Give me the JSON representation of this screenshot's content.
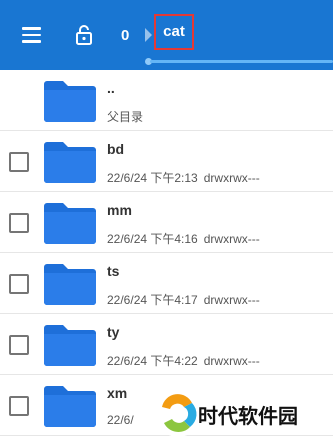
{
  "toolbar": {
    "menu_icon": "hamburger-menu-icon",
    "lock_icon": "lock-open-icon",
    "breadcrumb": {
      "root": "0",
      "current": "cat"
    },
    "accent_color": "#1976d2",
    "highlight_color": "#e53935"
  },
  "files": [
    {
      "name": "..",
      "date": "",
      "permissions": "",
      "subtitle": "父目录",
      "is_parent": true
    },
    {
      "name": "bd",
      "date": "22/6/24 下午2:13",
      "permissions": "drwxrwx---"
    },
    {
      "name": "mm",
      "date": "22/6/24 下午4:16",
      "permissions": "drwxrwx---"
    },
    {
      "name": "ts",
      "date": "22/6/24 下午4:17",
      "permissions": "drwxrwx---"
    },
    {
      "name": "ty",
      "date": "22/6/24 下午4:22",
      "permissions": "drwxrwx---"
    },
    {
      "name": "xm",
      "date": "22/6/",
      "permissions": ""
    }
  ],
  "watermark": {
    "text": "时代软件园"
  }
}
